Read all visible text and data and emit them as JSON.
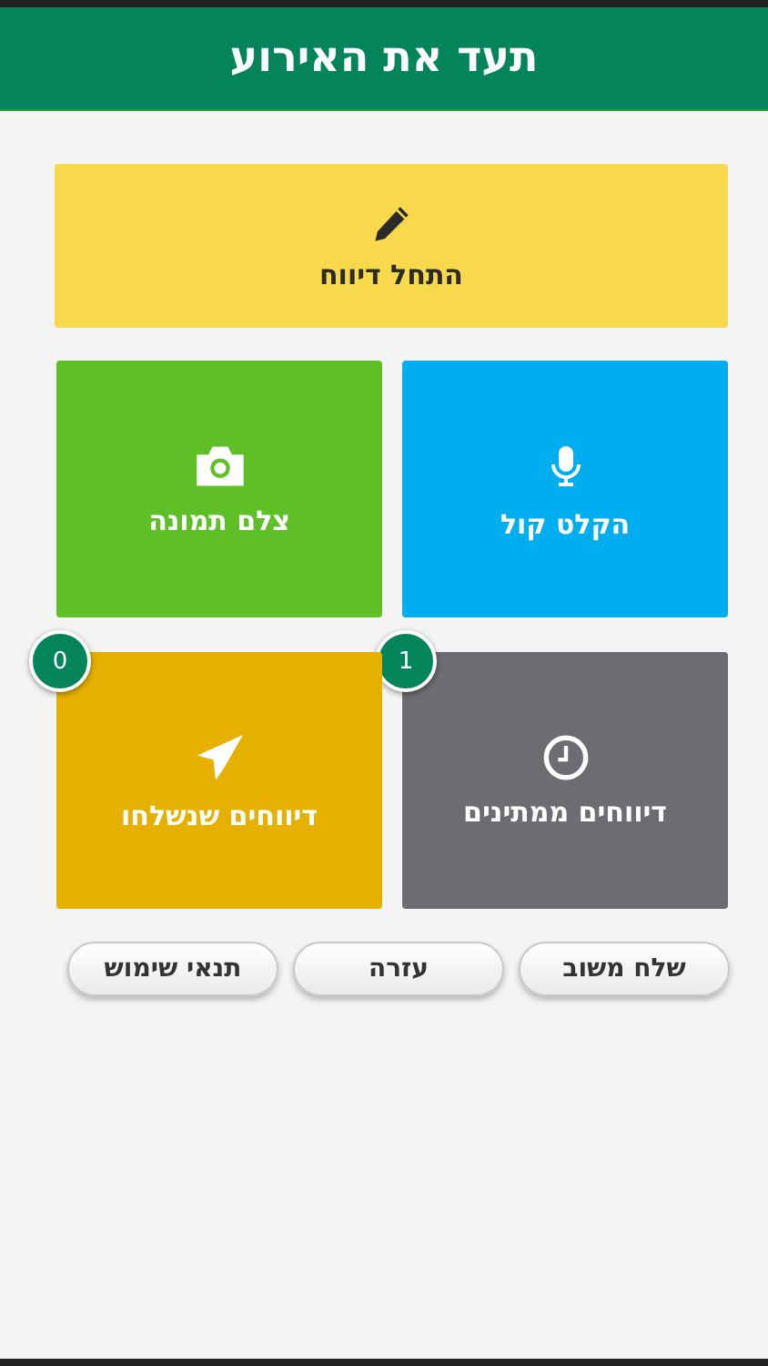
{
  "header": {
    "title": "תעד את האירוע"
  },
  "start_tile": {
    "label": "התחל דיווח"
  },
  "tiles": [
    {
      "kind": "voice",
      "label": "הקלט קול",
      "color": "#00adef"
    },
    {
      "kind": "photo",
      "label": "צלם תמונה",
      "color": "#5ebf27"
    },
    {
      "kind": "pending",
      "label": "דיווחים ממתינים",
      "color": "#6c6d71",
      "count": "1"
    },
    {
      "kind": "sent",
      "label": "דיווחים שנשלחו",
      "color": "#e5b000",
      "count": "0"
    }
  ],
  "buttons": [
    "שלח משוב",
    "עזרה",
    "תנאי שימוש"
  ]
}
